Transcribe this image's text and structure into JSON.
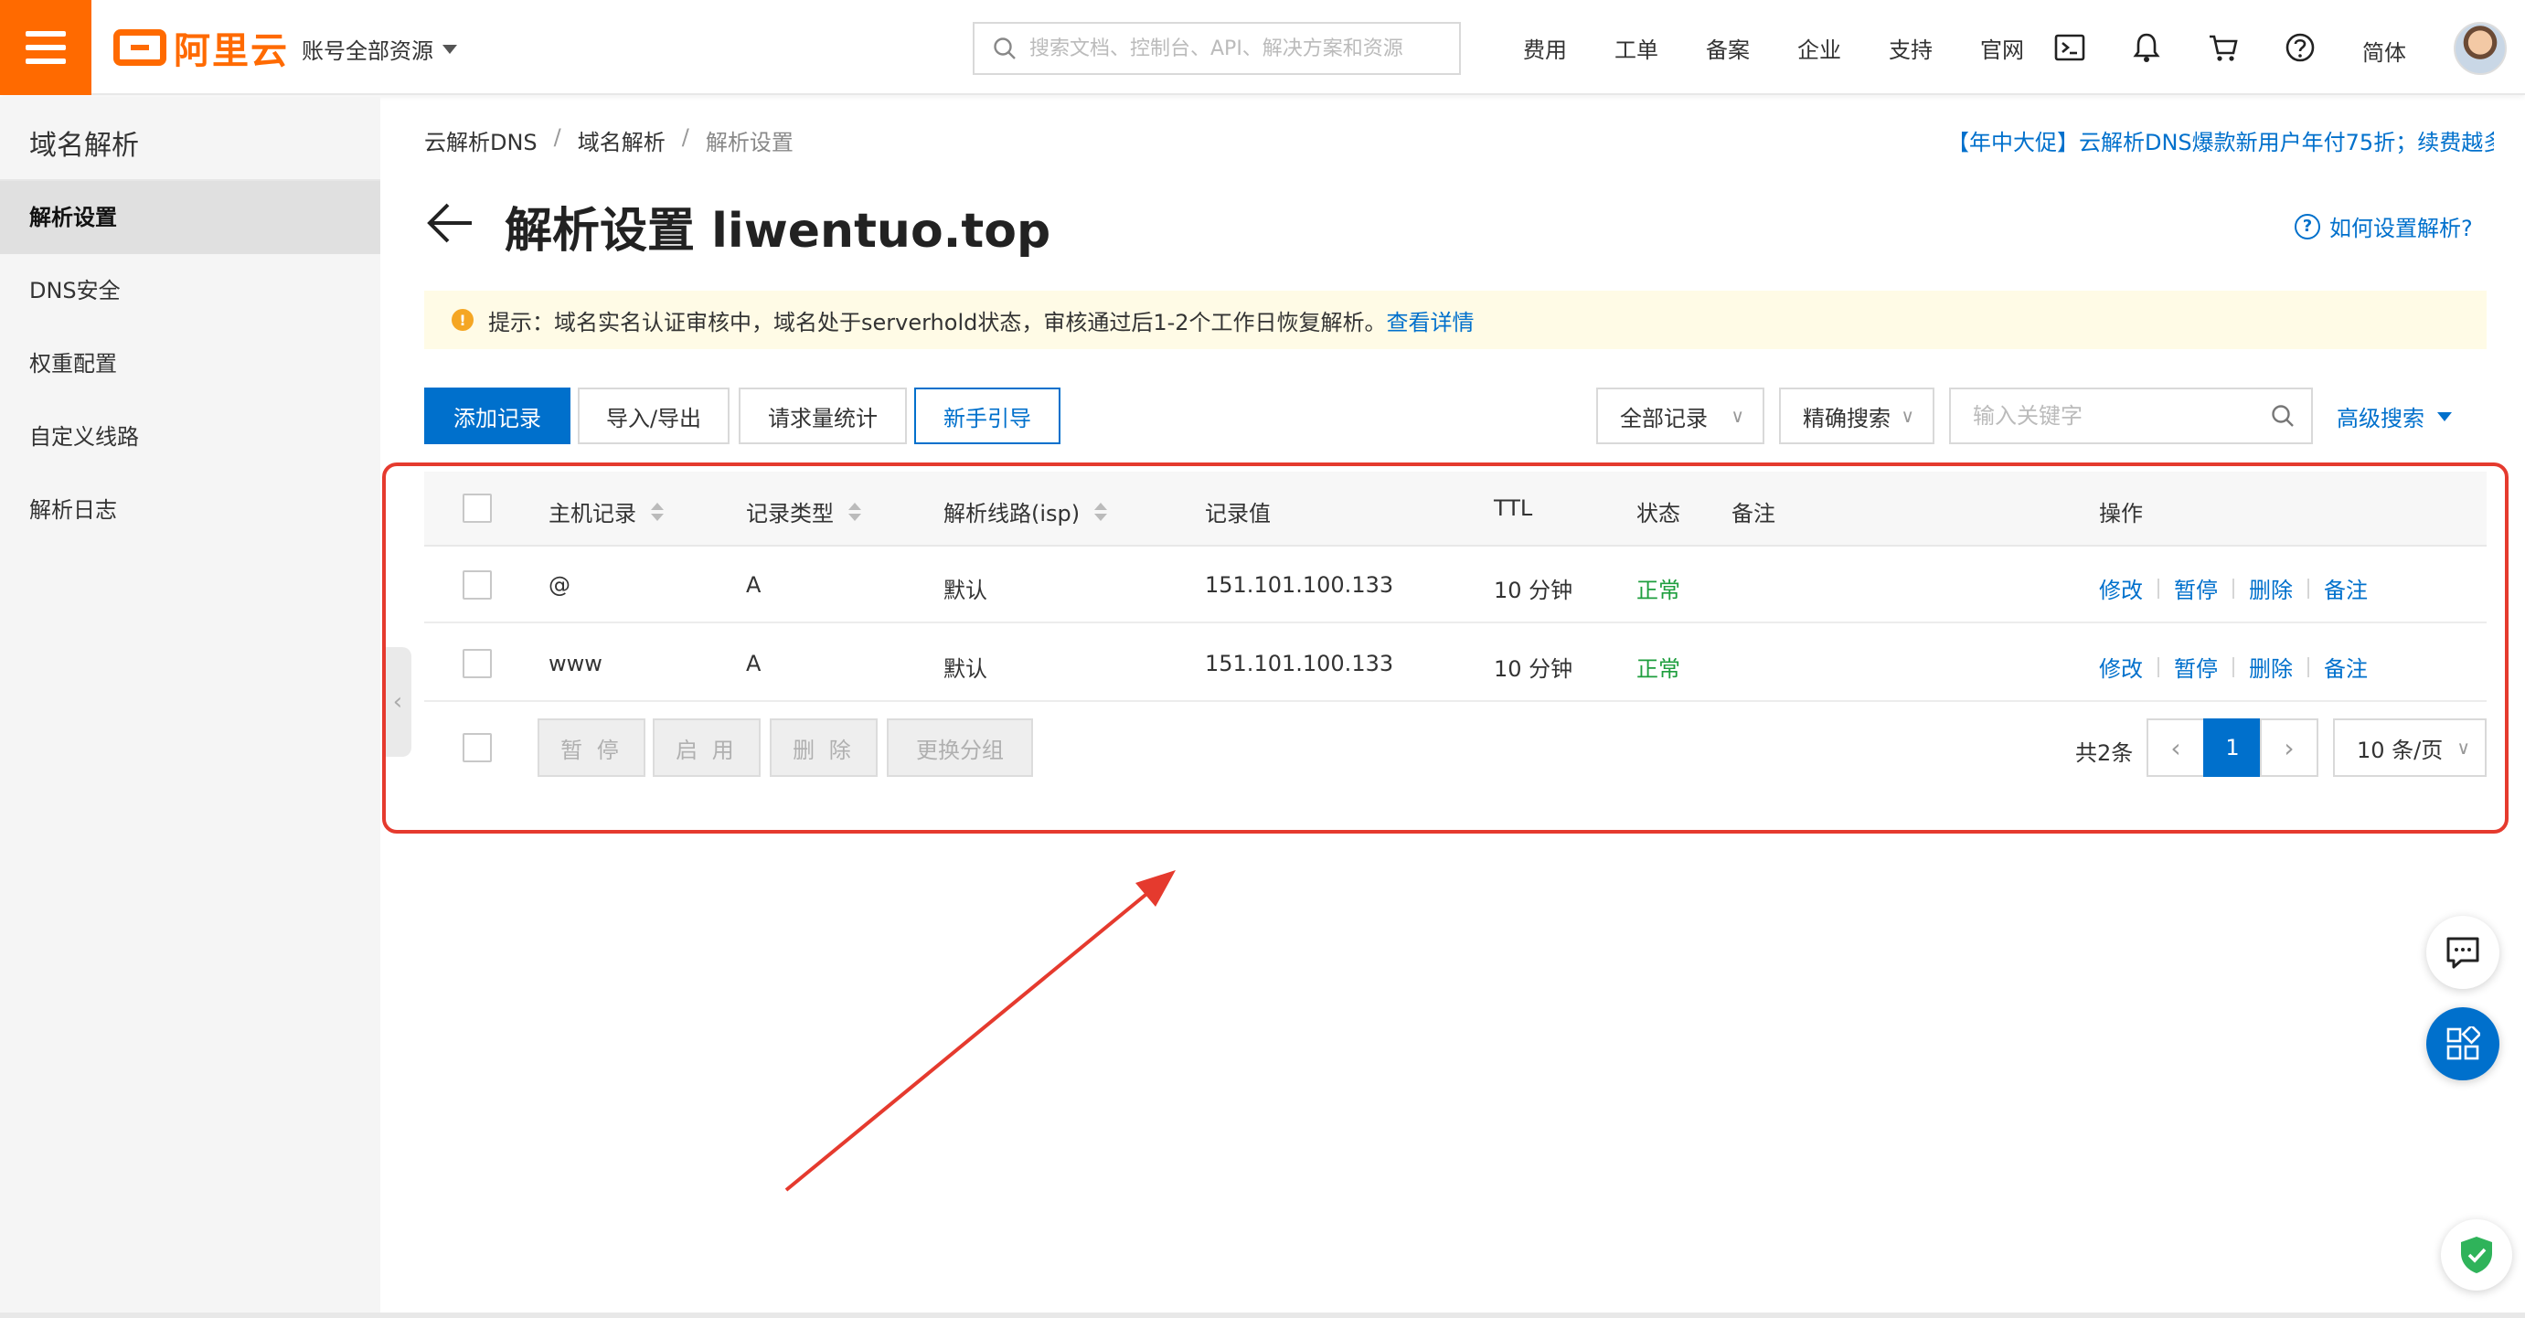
{
  "topbar": {
    "logo_text": "阿里云",
    "account_scope": "账号全部资源",
    "search_placeholder": "搜索文档、控制台、API、解决方案和资源",
    "nav": [
      "费用",
      "工单",
      "备案",
      "企业",
      "支持",
      "官网"
    ],
    "icons": [
      "terminal-icon",
      "bell-icon",
      "cart-icon",
      "help-icon"
    ],
    "language": "简体",
    "brand_color": "#ff6a00"
  },
  "sidebar": {
    "title": "域名解析",
    "items": [
      {
        "label": "解析设置",
        "active": true
      },
      {
        "label": "DNS安全",
        "active": false
      },
      {
        "label": "权重配置",
        "active": false
      },
      {
        "label": "自定义线路",
        "active": false
      },
      {
        "label": "解析日志",
        "active": false
      }
    ]
  },
  "breadcrumb": [
    "云解析DNS",
    "域名解析",
    "解析设置"
  ],
  "promo_text": "【年中大促】云解析DNS爆款新用户年付75折；续费越多",
  "page": {
    "title": "解析设置 liwentuo.top",
    "help_link": "如何设置解析?"
  },
  "notice": {
    "text": "提示：域名实名认证审核中，域名处于serverhold状态，审核通过后1-2个工作日恢复解析。",
    "link": "查看详情"
  },
  "toolbar": {
    "add_record": "添加记录",
    "import_export": "导入/导出",
    "request_stats": "请求量统计",
    "guide": "新手引导",
    "record_filter": "全部记录",
    "search_mode": "精确搜索",
    "keyword_placeholder": "输入关键字",
    "advanced_search": "高级搜索"
  },
  "table": {
    "columns": [
      "主机记录",
      "记录类型",
      "解析线路(isp)",
      "记录值",
      "TTL",
      "状态",
      "备注",
      "操作"
    ],
    "rows": [
      {
        "host": "@",
        "type": "A",
        "line": "默认",
        "value": "151.101.100.133",
        "ttl": "10 分钟",
        "status": "正常",
        "note": ""
      },
      {
        "host": "www",
        "type": "A",
        "line": "默认",
        "value": "151.101.100.133",
        "ttl": "10 分钟",
        "status": "正常",
        "note": ""
      }
    ],
    "row_actions": [
      "修改",
      "暂停",
      "删除",
      "备注"
    ],
    "status_color": "#1e9e3e"
  },
  "batch": {
    "pause": "暂 停",
    "enable": "启 用",
    "delete": "删 除",
    "change_group": "更换分组"
  },
  "pagination": {
    "total": "共2条",
    "current_page": "1",
    "page_size": "10 条/页"
  },
  "annotation_color": "#e53a2e",
  "accent_color": "#0070cc"
}
